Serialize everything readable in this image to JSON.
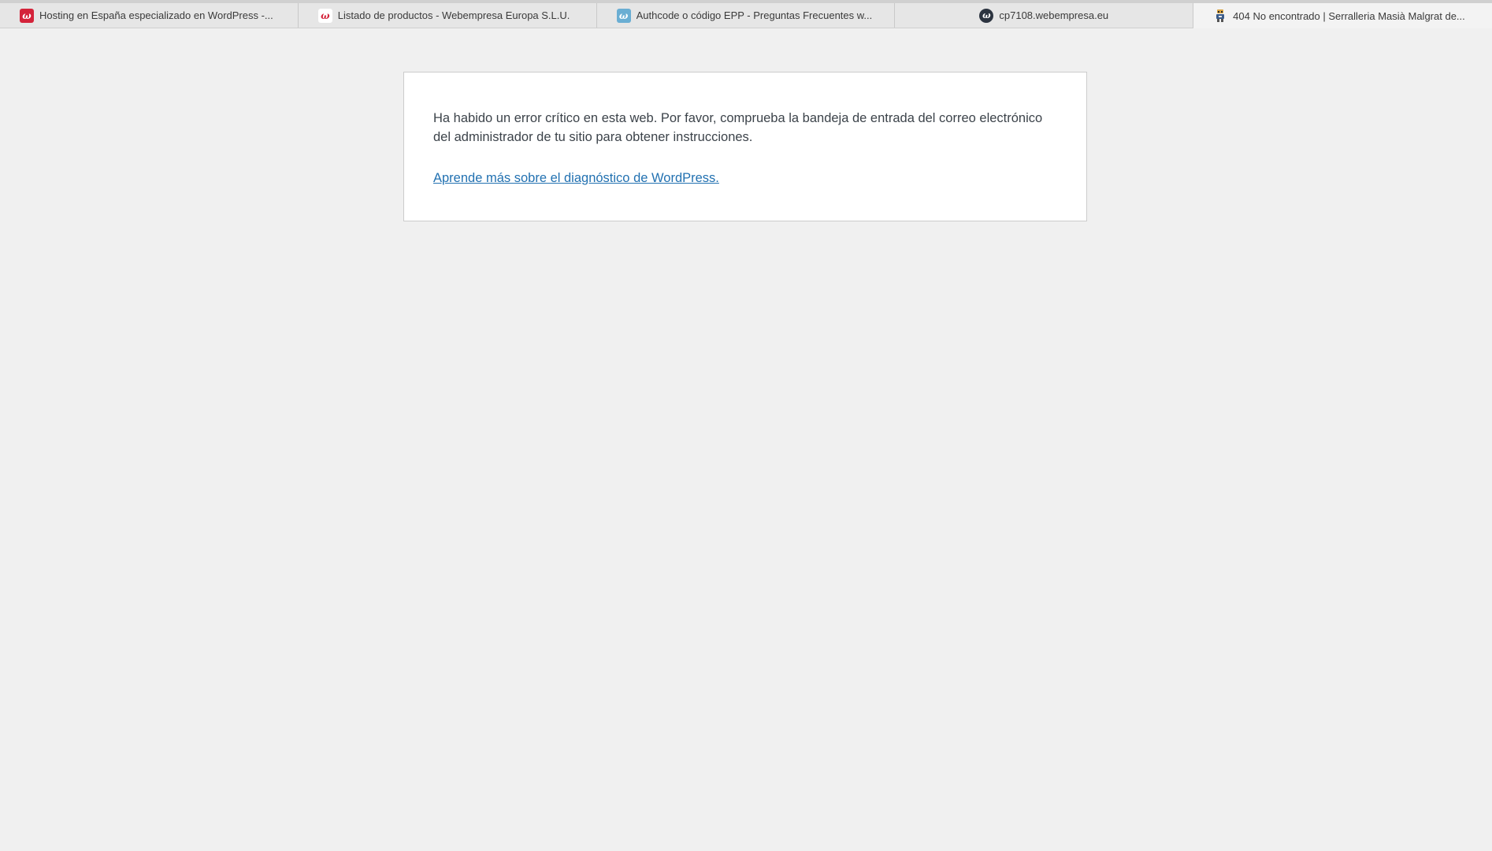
{
  "browser": {
    "tabs": [
      {
        "title": "Hosting en España especializado en WordPress -...",
        "favicon": "webempresa-red-icon",
        "active": false
      },
      {
        "title": "Listado de productos - Webempresa Europa S.L.U.",
        "favicon": "webempresa-white-icon",
        "active": false
      },
      {
        "title": "Authcode o código EPP - Preguntas Frecuentes w...",
        "favicon": "webempresa-blue-icon",
        "active": false
      },
      {
        "title": "cp7108.webempresa.eu",
        "favicon": "webempresa-dark-icon",
        "active": false
      },
      {
        "title": "404 No encontrado | Serralleria Masià Malgrat de...",
        "favicon": "robot-icon",
        "active": true
      }
    ],
    "favicon_glyph": "ω"
  },
  "page": {
    "error_message": "Ha habido un error crítico en esta web. Por favor, comprueba la bandeja de entrada del correo electrónico del administrador de tu sitio para obtener instrucciones.",
    "link_text": "Aprende más sobre el diagnóstico de WordPress.",
    "link_color": "#2271b1",
    "background_color": "#f0f0f0"
  }
}
